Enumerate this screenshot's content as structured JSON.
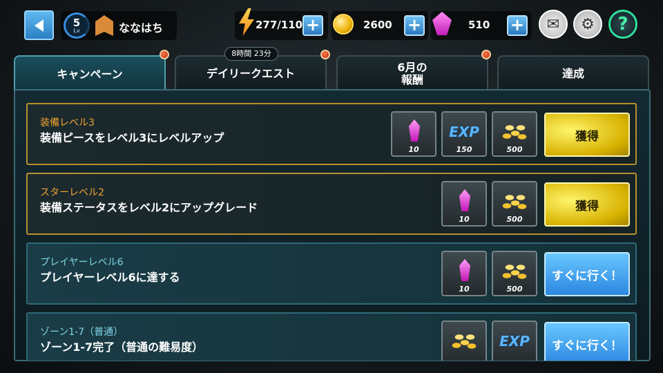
{
  "top_bar": {
    "player": {
      "level": "5",
      "level_label": "Lv",
      "name": "ななはち"
    },
    "energy": {
      "value": "277/110",
      "icon": "lightning-icon"
    },
    "gold": {
      "value": "2600",
      "icon": "coin-icon"
    },
    "gems": {
      "value": "510",
      "icon": "gem-icon"
    },
    "plus_label": "+",
    "buttons": [
      "back-button",
      "mail-button",
      "settings-button",
      "help-button"
    ],
    "help_label": "?"
  },
  "tabs": [
    {
      "label": "キャンペーン",
      "active": true
    },
    {
      "label": "デイリークエスト",
      "timer": "8時間 23分"
    },
    {
      "label": "6月の\n報酬"
    },
    {
      "label": "達成"
    }
  ],
  "missions": [
    {
      "title": "装備レベル3",
      "description": "装備ピースをレベル3にレベルアップ",
      "style": "gold",
      "rewards": [
        {
          "type": "gem",
          "amount": "10"
        },
        {
          "type": "exp",
          "label": "EXP",
          "amount": "150"
        },
        {
          "type": "gold",
          "amount": "500"
        }
      ],
      "button": "獲得"
    },
    {
      "title": "スターレベル2",
      "description": "装備ステータスをレベル2にアップグレード",
      "style": "gold",
      "rewards": [
        {
          "type": "gem",
          "amount": "10"
        },
        {
          "type": "gold",
          "amount": "500"
        }
      ],
      "button": "獲得"
    },
    {
      "title": "プレイヤーレベル6",
      "description": "プレイヤーレベル6に達する",
      "style": "teal",
      "rewards": [
        {
          "type": "gem",
          "amount": "10"
        },
        {
          "type": "gold",
          "amount": "500"
        }
      ],
      "button": "すぐに行く！"
    },
    {
      "title": "ゾーン1-7（普通）",
      "description": "ゾーン1-7完了（普通の難易度）",
      "style": "teal",
      "rewards": [
        {
          "type": "gold",
          "amount": ""
        },
        {
          "type": "exp",
          "label": "EXP",
          "amount": ""
        }
      ],
      "button": "すぐに行く！"
    }
  ]
}
